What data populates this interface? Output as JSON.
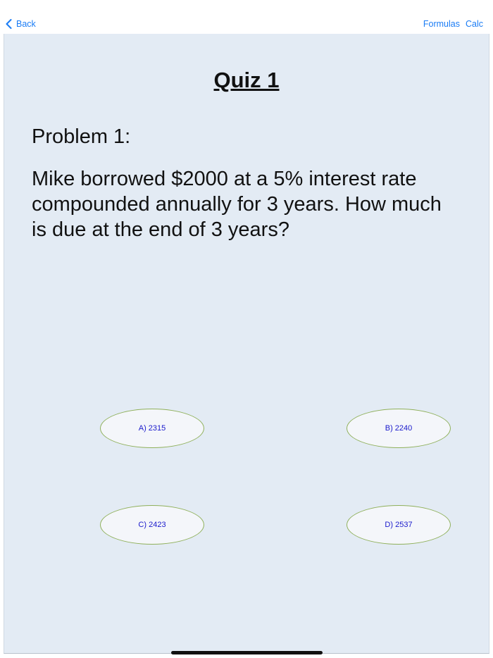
{
  "nav": {
    "back_label": "Back",
    "formulas_label": "Formulas",
    "calc_label": "Calc"
  },
  "quiz": {
    "title": "Quiz 1",
    "problem_label": "Problem 1:",
    "problem_text": "Mike borrowed $2000 at a 5% interest rate compounded annually for 3 years. How much is due at the end of 3 years?"
  },
  "answers": [
    {
      "label": "A) 2315"
    },
    {
      "label": "B) 2240"
    },
    {
      "label": "C) 2423"
    },
    {
      "label": "D) 2537"
    }
  ],
  "colors": {
    "accent": "#1a7cf5",
    "background": "#e3ebf4",
    "answer_border": "#8fb05a",
    "answer_text": "#1a1acc"
  },
  "icons": {
    "back": "chevron-left-icon"
  }
}
